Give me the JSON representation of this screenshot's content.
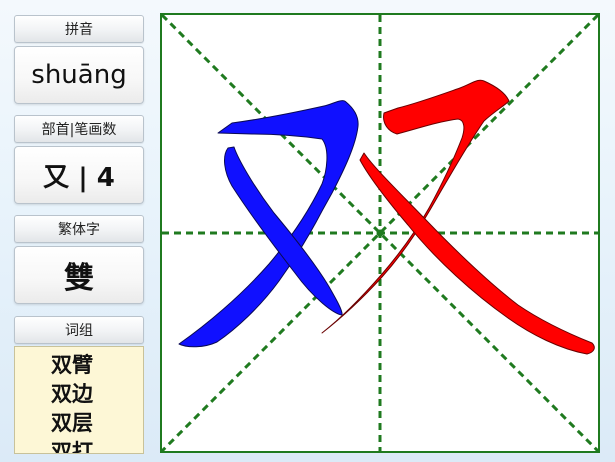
{
  "pinyin": {
    "label": "拼音",
    "value": "shuāng"
  },
  "radical_strokes": {
    "label": "部首|笔画数",
    "value": "又 | 4"
  },
  "traditional": {
    "label": "繁体字",
    "value": "雙"
  },
  "word_group": {
    "label": "词组",
    "words": [
      "双臂",
      "双边",
      "双层",
      "双打"
    ]
  },
  "character_canvas": {
    "character": "双",
    "stroke_colors": {
      "left_component": "#1010ff",
      "right_component": "#ff0000"
    },
    "guide_color": "#1f7a1f"
  }
}
